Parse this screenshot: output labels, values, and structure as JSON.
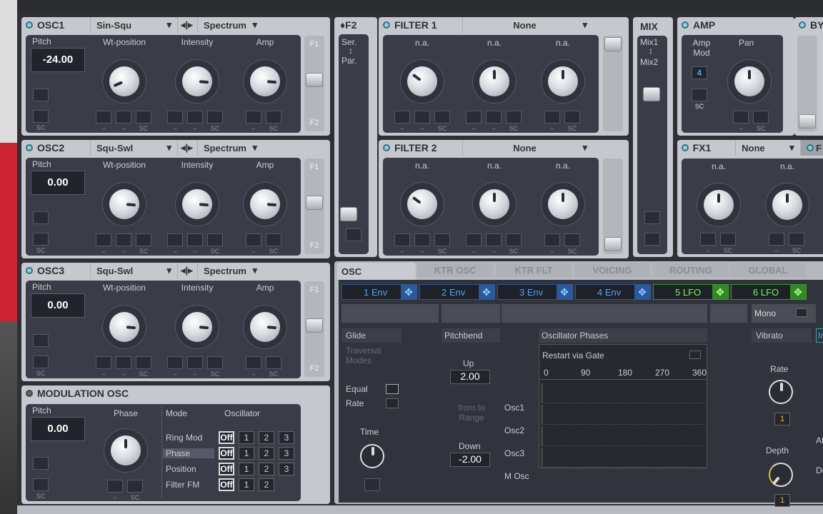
{
  "osc": [
    {
      "name": "OSC1",
      "wavetable": "Sin-Squ",
      "mode": "Spectrum",
      "pitch_label": "Pitch",
      "pitch": "-24.00",
      "knobs": [
        {
          "label": "Wt-position",
          "value": 0.08
        },
        {
          "label": "Intensity",
          "value": 0.85
        },
        {
          "label": "Amp",
          "value": 0.85
        }
      ]
    },
    {
      "name": "OSC2",
      "wavetable": "Squ-Swl",
      "mode": "Spectrum",
      "pitch_label": "Pitch",
      "pitch": "0.00",
      "knobs": [
        {
          "label": "Wt-position",
          "value": 0.85
        },
        {
          "label": "Intensity",
          "value": 0.85
        },
        {
          "label": "Amp",
          "value": 0.85
        }
      ]
    },
    {
      "name": "OSC3",
      "wavetable": "Squ-Swl",
      "mode": "Spectrum",
      "pitch_label": "Pitch",
      "pitch": "0.00",
      "knobs": [
        {
          "label": "Wt-position",
          "value": 0.85
        },
        {
          "label": "Intensity",
          "value": 0.85
        },
        {
          "label": "Amp",
          "value": 0.85
        }
      ]
    }
  ],
  "slot_labels": {
    "dash": "–",
    "sc": "SC"
  },
  "fader_labels": {
    "top": "F1",
    "bottom": "F2"
  },
  "modosc": {
    "name": "MODULATION OSC",
    "pitch_label": "Pitch",
    "pitch": "0.00",
    "phase_label": "Phase",
    "mode_label": "Mode",
    "osc_label": "Oscillator",
    "rows": [
      {
        "label": "Ring Mod",
        "opts": [
          "Off",
          "1",
          "2",
          "3"
        ]
      },
      {
        "label": "Phase",
        "opts": [
          "Off",
          "1",
          "2",
          "3"
        ]
      },
      {
        "label": "Position",
        "opts": [
          "Off",
          "1",
          "2",
          "3"
        ]
      },
      {
        "label": "Filter FM",
        "opts": [
          "Off",
          "1",
          "2"
        ]
      }
    ]
  },
  "f2": {
    "label": "♦F2",
    "ser": "Ser.",
    "arrow": "↕",
    "par": "Par."
  },
  "filters": [
    {
      "name": "FILTER 1",
      "type": "None",
      "knobs": [
        {
          "label": "n.a.",
          "value": 0.3
        },
        {
          "label": "n.a.",
          "value": 0.5
        },
        {
          "label": "n.a.",
          "value": 0.5
        }
      ]
    },
    {
      "name": "FILTER 2",
      "type": "None",
      "knobs": [
        {
          "label": "n.a.",
          "value": 0.3
        },
        {
          "label": "n.a.",
          "value": 0.5
        },
        {
          "label": "n.a.",
          "value": 0.5
        }
      ]
    }
  ],
  "mix": {
    "label": "MIX",
    "mix1": "Mix1",
    "arrow": "↕",
    "mix2": "Mix2"
  },
  "amp": {
    "name": "AMP",
    "amp_mod": "Amp Mod",
    "amp_mod_value": "4",
    "pan": "Pan",
    "pan_value": 0.5,
    "sc": "SC"
  },
  "bypass": {
    "name": "BY"
  },
  "fx1": {
    "name": "FX1",
    "type": "None",
    "knobs": [
      {
        "label": "n.a.",
        "value": 0.5
      },
      {
        "label": "n.a.",
        "value": 0.5
      }
    ],
    "next": "F"
  },
  "tabs": [
    "OSC",
    "KTR OSC",
    "KTR FLT",
    "VOICING",
    "ROUTING",
    "GLOBAL"
  ],
  "sources": [
    {
      "label": "1 Env",
      "kind": "env"
    },
    {
      "label": "2 Env",
      "kind": "env"
    },
    {
      "label": "3 Env",
      "kind": "env"
    },
    {
      "label": "4 Env",
      "kind": "env"
    },
    {
      "label": "5 LFO",
      "kind": "lfo"
    },
    {
      "label": "6 LFO",
      "kind": "lfo"
    }
  ],
  "osc_tab": {
    "mono": "Mono",
    "glide": "Glide",
    "traversal": "Traversal Modes",
    "equal": "Equal",
    "rate": "Rate",
    "time": "Time",
    "pitchbend": "Pitchbend",
    "up": "Up",
    "up_value": "2.00",
    "from_to": "from to Range",
    "down": "Down",
    "down_value": "-2.00",
    "phases": "Oscillator Phases",
    "restart": "Restart via Gate",
    "ticks": [
      "0",
      "90",
      "180",
      "270",
      "360"
    ],
    "rows": [
      "Osc1",
      "Osc2",
      "Osc3",
      "M Osc"
    ],
    "vibrato": "Vibrato",
    "vib_rate": "Rate",
    "vib_rate_value": "1",
    "vib_depth": "Depth",
    "vib_depth_value": "1",
    "in": "In",
    "af": "Af",
    "de": "De"
  },
  "colors": {
    "led": "#7fd8e6",
    "env": "#4aa3ff",
    "lfo": "#6fff4a",
    "accent": "#e8c020"
  }
}
